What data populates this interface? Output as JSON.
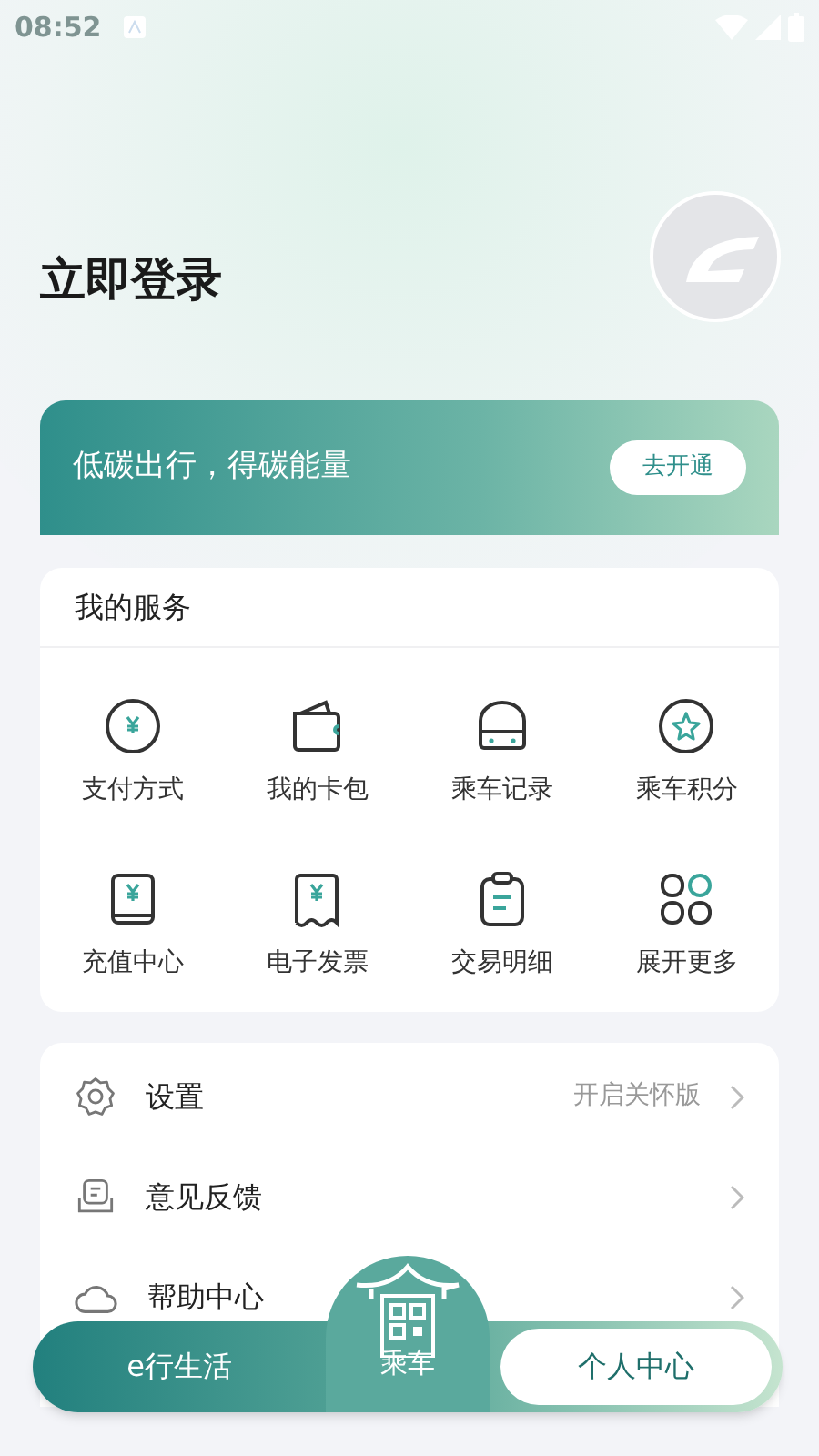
{
  "status_bar": {
    "time": "08:52"
  },
  "login": {
    "title": "立即登录"
  },
  "banner": {
    "text": "低碳出行，得碳能量",
    "button": "去开通"
  },
  "services": {
    "title": "我的服务",
    "items": [
      {
        "label": "支付方式",
        "kind": "pay"
      },
      {
        "label": "我的卡包",
        "kind": "wallet"
      },
      {
        "label": "乘车记录",
        "kind": "bus"
      },
      {
        "label": "乘车积分",
        "kind": "points"
      },
      {
        "label": "充值中心",
        "kind": "recharge"
      },
      {
        "label": "电子发票",
        "kind": "invoice"
      },
      {
        "label": "交易明细",
        "kind": "detail"
      },
      {
        "label": "展开更多",
        "kind": "more"
      }
    ]
  },
  "menu": [
    {
      "label": "设置",
      "kind": "settings",
      "hint": "开启关怀版"
    },
    {
      "label": "意见反馈",
      "kind": "feedback"
    },
    {
      "label": "帮助中心",
      "kind": "help"
    }
  ],
  "bottom_nav": [
    {
      "label": "e行生活",
      "kind": "tab",
      "selected": false
    },
    {
      "label": "乘车",
      "kind": "center",
      "selected": false
    },
    {
      "label": "个人中心",
      "kind": "tab",
      "selected": true
    }
  ]
}
